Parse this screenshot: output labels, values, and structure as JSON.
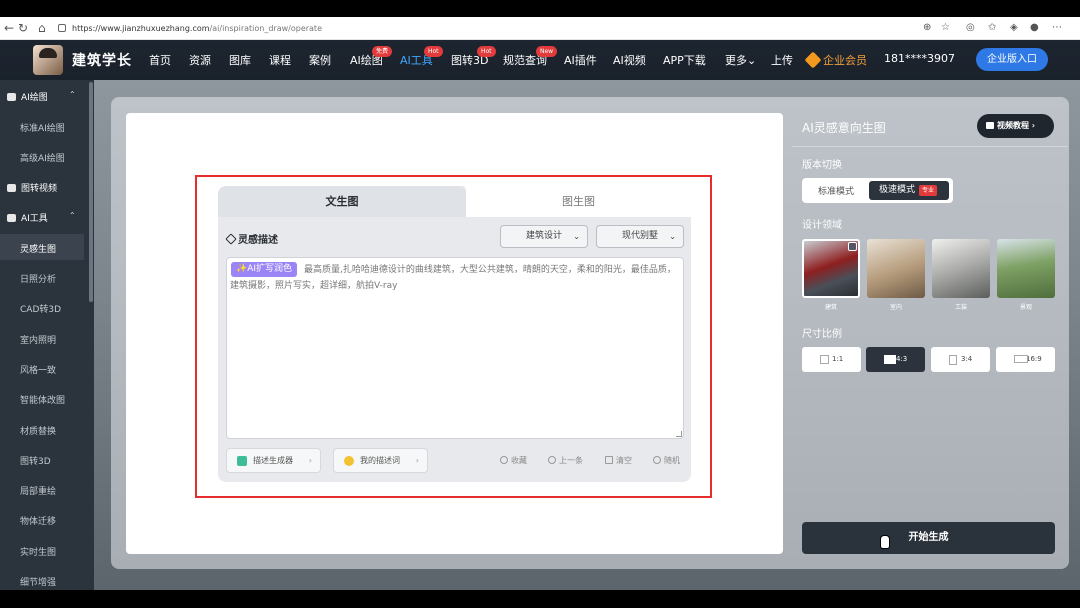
{
  "browser": {
    "url_host": "https://www.jianzhuxuezhang.com",
    "url_path": "/ai/inspiration_draw/operate"
  },
  "site": {
    "logo_text": "建筑学长",
    "nav": [
      {
        "label": "首页"
      },
      {
        "label": "资源"
      },
      {
        "label": "图库"
      },
      {
        "label": "课程"
      },
      {
        "label": "案例"
      },
      {
        "label": "AI绘图",
        "badge": "免费"
      },
      {
        "label": "AI工具",
        "badge": "Hot"
      },
      {
        "label": "图转3D",
        "badge": "Hot"
      },
      {
        "label": "规范查询",
        "badge": "New"
      },
      {
        "label": "AI插件"
      },
      {
        "label": "AI视频"
      },
      {
        "label": "APP下载"
      },
      {
        "label": "更多"
      },
      {
        "label": "上传"
      }
    ],
    "vip_label": "企业会员",
    "phone": "181****3907",
    "enterprise_btn": "企业版入口"
  },
  "sidebar": {
    "sections": [
      {
        "label": "AI绘图",
        "items": [
          "标准AI绘图",
          "高级AI绘图"
        ]
      },
      {
        "label": "图转视频",
        "items": []
      },
      {
        "label": "AI工具",
        "items": [
          "灵感生图",
          "日照分析",
          "CAD转3D",
          "室内照明",
          "风格一致",
          "智能体改图",
          "材质替换",
          "图转3D",
          "局部重绘",
          "物体迁移",
          "实时生图",
          "细节增强"
        ]
      }
    ]
  },
  "generator": {
    "tabs": [
      "文生图",
      "图生图"
    ],
    "desc_label": "灵感描述",
    "select1": "建筑设计",
    "select2": "现代别墅",
    "ai_tag": "✨AI扩写润色",
    "prompt": "最高质量,扎哈哈迪德设计的曲线建筑，大型公共建筑，晴朗的天空，柔和的阳光，最佳品质，建筑摄影，照片写实，超详细，航拍V-ray",
    "btn_generator": "描述生成器",
    "btn_my": "我的描述词",
    "actions": [
      "收藏",
      "上一条",
      "清空",
      "随机"
    ]
  },
  "right_panel": {
    "title": "AI灵感意向生图",
    "video_btn": "视频教程",
    "version_label": "版本切换",
    "mode_std": "标准模式",
    "mode_fast": "极速模式",
    "mode_fast_badge": "专业",
    "field_label": "设计领域",
    "fields": [
      "建筑",
      "室内",
      "工装",
      "景观"
    ],
    "ratio_label": "尺寸比例",
    "ratios": [
      "1:1",
      "4:3",
      "3:4",
      "16:9"
    ],
    "selected_ratio": "4:3",
    "generate_btn": "开始生成"
  }
}
